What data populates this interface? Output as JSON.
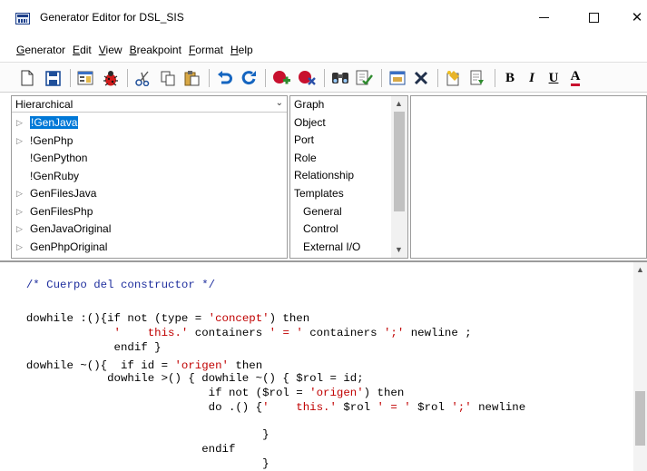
{
  "window": {
    "title": "Generator Editor for DSL_SIS",
    "minimize": "—",
    "maximize": "☐",
    "close": "✕"
  },
  "menu": [
    {
      "label": "Generator",
      "underline": "G",
      "rest": "enerator"
    },
    {
      "label": "Edit",
      "underline": "E",
      "rest": "dit"
    },
    {
      "label": "View",
      "underline": "V",
      "rest": "iew"
    },
    {
      "label": "Breakpoint",
      "underline": "B",
      "rest": "reakpoint"
    },
    {
      "label": "Format",
      "underline": "F",
      "rest": "ormat"
    },
    {
      "label": "Help",
      "underline": "H",
      "rest": "elp"
    }
  ],
  "toolbar": {
    "icons": [
      "new-file-icon",
      "save-icon",
      "properties-icon",
      "bug-icon",
      "cut-icon",
      "copy-icon",
      "paste-icon",
      "undo-icon",
      "redo-icon",
      "add-breakpoint-icon",
      "remove-breakpoint-icon",
      "find-icon",
      "check-icon",
      "dialog-icon",
      "delete-icon",
      "edit-note-icon",
      "insert-icon",
      "bold-icon",
      "italic-icon",
      "underline-icon",
      "font-color-icon"
    ],
    "bold_label": "B",
    "italic_label": "I",
    "underline_label": "U",
    "font_color_label": "A",
    "colors": {
      "accent_red": "#c8102e",
      "undo_blue": "#1565c0",
      "selected_bg": "#0078d7"
    }
  },
  "left_panel": {
    "dropdown_value": "Hierarchical",
    "tree": [
      {
        "label": "!GenJava",
        "expandable": true,
        "selected": true
      },
      {
        "label": "!GenPhp",
        "expandable": true,
        "selected": false
      },
      {
        "label": "!GenPython",
        "expandable": false,
        "selected": false
      },
      {
        "label": "!GenRuby",
        "expandable": false,
        "selected": false
      },
      {
        "label": "GenFilesJava",
        "expandable": true,
        "selected": false
      },
      {
        "label": "GenFilesPhp",
        "expandable": true,
        "selected": false
      },
      {
        "label": "GenJavaOriginal",
        "expandable": true,
        "selected": false
      },
      {
        "label": "GenPhpOriginal",
        "expandable": true,
        "selected": false
      }
    ]
  },
  "middle_panel": {
    "items": [
      {
        "label": "Graph",
        "indent": false
      },
      {
        "label": "Object",
        "indent": false
      },
      {
        "label": "Port",
        "indent": false
      },
      {
        "label": "Role",
        "indent": false
      },
      {
        "label": "Relationship",
        "indent": false
      },
      {
        "label": "Templates",
        "indent": false
      },
      {
        "label": "General",
        "indent": true
      },
      {
        "label": "Control",
        "indent": true
      },
      {
        "label": "External I/O",
        "indent": true
      }
    ],
    "scroll_position": 0.0
  },
  "editor": {
    "lines": [
      [
        {
          "t": "  /* Cuerpo del constructor */",
          "c": "cm"
        }
      ],
      [
        {
          "t": "",
          "c": ""
        }
      ],
      [
        {
          "t": "  dowhile :(){if not (type = ",
          "c": ""
        },
        {
          "t": "'concept'",
          "c": "str"
        },
        {
          "t": ") then",
          "c": ""
        }
      ],
      [
        {
          "t": "               ",
          "c": ""
        },
        {
          "t": "'    this.'",
          "c": "str"
        },
        {
          "t": " containers ",
          "c": ""
        },
        {
          "t": "' = '",
          "c": "str"
        },
        {
          "t": " containers ",
          "c": ""
        },
        {
          "t": "';'",
          "c": "str"
        },
        {
          "t": " newline ;",
          "c": ""
        }
      ],
      [
        {
          "t": "               endif }",
          "c": ""
        }
      ],
      [
        {
          "t": "  dowhile ~(){  if id = ",
          "c": ""
        },
        {
          "t": "'origen'",
          "c": "str"
        },
        {
          "t": " then",
          "c": ""
        }
      ],
      [
        {
          "t": "              dowhile >() { dowhile ~() { $rol = id;",
          "c": ""
        }
      ],
      [
        {
          "t": "                             if not ($rol = ",
          "c": ""
        },
        {
          "t": "'origen'",
          "c": "str"
        },
        {
          "t": ") then",
          "c": ""
        }
      ],
      [
        {
          "t": "                             do .() {",
          "c": ""
        },
        {
          "t": "'    this.'",
          "c": "str"
        },
        {
          "t": " $rol ",
          "c": ""
        },
        {
          "t": "' = '",
          "c": "str"
        },
        {
          "t": " $rol ",
          "c": ""
        },
        {
          "t": "';'",
          "c": "str"
        },
        {
          "t": " newline",
          "c": ""
        }
      ],
      [
        {
          "t": "",
          "c": ""
        }
      ],
      [
        {
          "t": "                                     }",
          "c": ""
        }
      ],
      [
        {
          "t": "                            endif",
          "c": ""
        }
      ],
      [
        {
          "t": "                                     }",
          "c": ""
        }
      ]
    ]
  }
}
